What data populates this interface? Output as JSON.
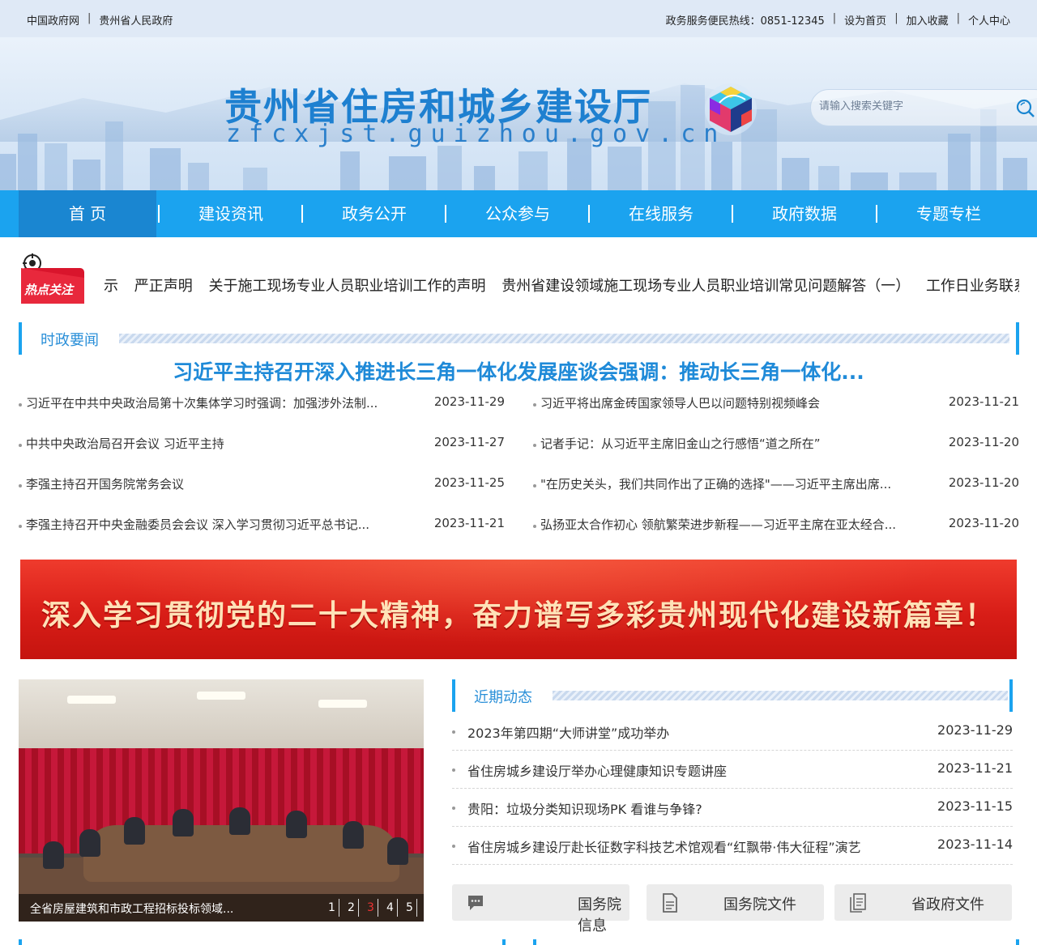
{
  "topbar": {
    "left_links": [
      "中国政府网",
      "贵州省人民政府"
    ],
    "hotline": "政务服务便民热线：0851-12345",
    "right_links": [
      "设为首页",
      "加入收藏",
      "个人中心"
    ]
  },
  "header": {
    "title": "贵州省住房和城乡建设厅",
    "domain": "zfcxjst.guizhou.gov.cn",
    "search_placeholder": "请输入搜索关键字"
  },
  "nav": {
    "items": [
      "首 页",
      "建设资讯",
      "政务公开",
      "公众参与",
      "在线服务",
      "政府数据",
      "专题专栏"
    ]
  },
  "hot": {
    "badge": "热点关注",
    "items": [
      "示",
      "严正声明",
      "关于施工现场专业人员职业培训工作的声明",
      "贵州省建设领域施工现场专业人员职业培训常见问题解答（一）",
      "工作日业务联系电"
    ]
  },
  "politics": {
    "label": "时政要闻",
    "headline": "习近平主持召开深入推进长三角一体化发展座谈会强调：推动长三角一体化...",
    "left": [
      {
        "title": "习近平在中共中央政治局第十次集体学习时强调：加强涉外法制...",
        "date": "2023-11-29"
      },
      {
        "title": "中共中央政治局召开会议 习近平主持",
        "date": "2023-11-27"
      },
      {
        "title": "李强主持召开国务院常务会议",
        "date": "2023-11-25"
      },
      {
        "title": "李强主持召开中央金融委员会会议 深入学习贯彻习近平总书记...",
        "date": "2023-11-21"
      }
    ],
    "right": [
      {
        "title": "习近平将出席金砖国家领导人巴以问题特别视频峰会",
        "date": "2023-11-21"
      },
      {
        "title": "记者手记：从习近平主席旧金山之行感悟“道之所在”",
        "date": "2023-11-20"
      },
      {
        "title": "\"在历史关头，我们共同作出了正确的选择\"——习近平主席出席...",
        "date": "2023-11-20"
      },
      {
        "title": "弘扬亚太合作初心 领航繁荣进步新程——习近平主席在亚太经合...",
        "date": "2023-11-20"
      }
    ]
  },
  "banner": {
    "text": "深入学习贯彻党的二十大精神，奋力谱写多彩贵州现代化建设新篇章！"
  },
  "photo": {
    "caption": "全省房屋建筑和市政工程招标投标领域...",
    "pages": [
      "1",
      "2",
      "3",
      "4",
      "5"
    ],
    "active_page": "3"
  },
  "recent": {
    "label": "近期动态",
    "items": [
      {
        "title": "2023年第四期“大师讲堂”成功举办",
        "date": "2023-11-29"
      },
      {
        "title": "省住房城乡建设厅举办心理健康知识专题讲座",
        "date": "2023-11-21"
      },
      {
        "title": "贵阳：垃圾分类知识现场PK 看谁与争锋?",
        "date": "2023-11-15"
      },
      {
        "title": "省住房城乡建设厅赴长征数字科技艺术馆观看“红飘带·伟大征程”演艺",
        "date": "2023-11-14"
      }
    ]
  },
  "quick_links": [
    {
      "label": "国务院信息",
      "icon": "chat-icon"
    },
    {
      "label": "国务院文件",
      "icon": "document-icon"
    },
    {
      "label": "省政府文件",
      "icon": "file-icon"
    }
  ],
  "colors": {
    "nav_blue": "#1ba3ef",
    "nav_active": "#1a86d1",
    "title_blue": "#1f8ad8",
    "banner_red": "#d81d17"
  }
}
